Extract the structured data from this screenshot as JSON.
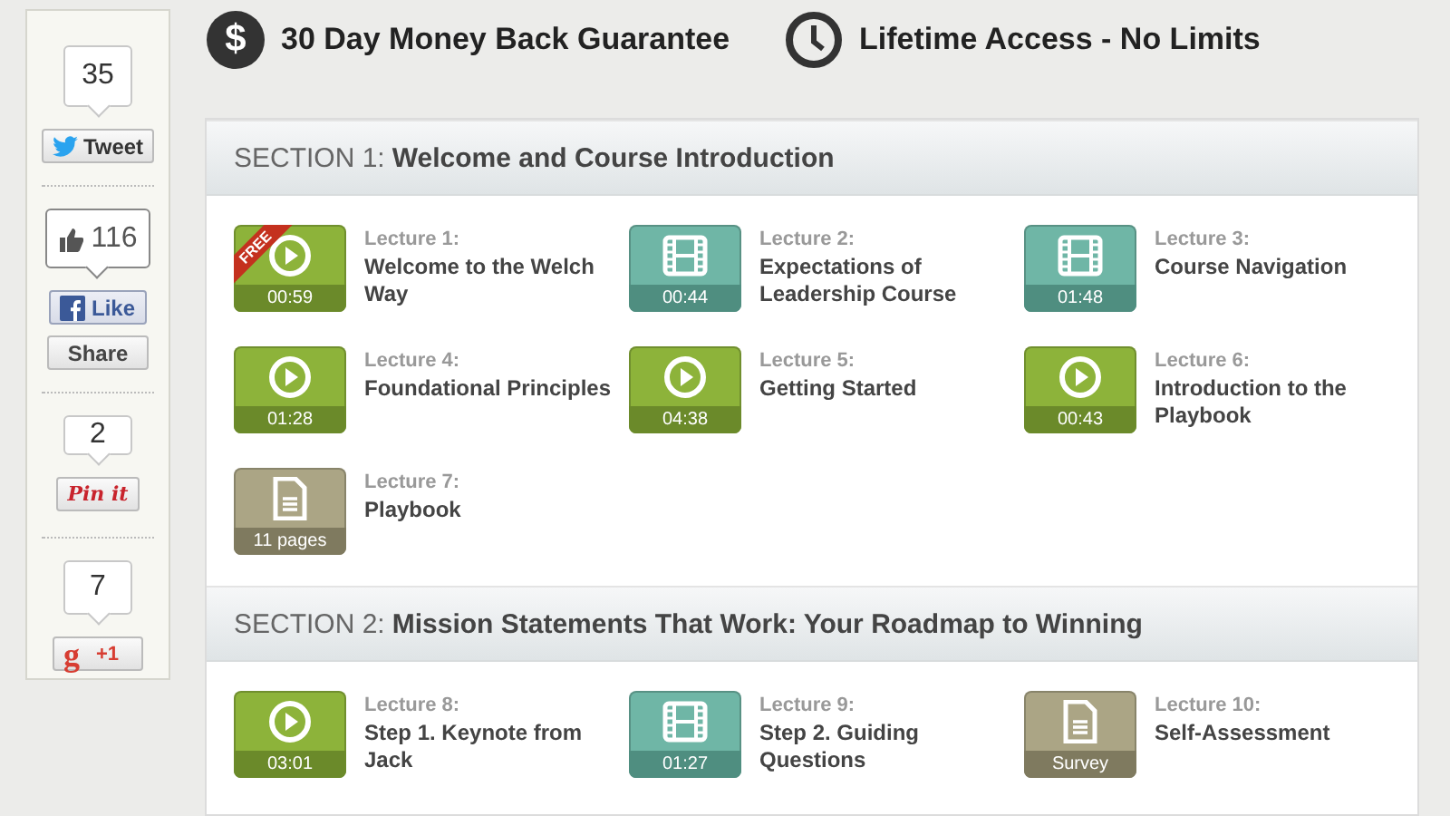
{
  "social": [
    {
      "kind": "twitter",
      "count": "35",
      "buttons": [
        "Tweet"
      ]
    },
    {
      "kind": "facebook",
      "count": "116",
      "buttons": [
        "Like",
        "Share"
      ]
    },
    {
      "kind": "pinterest",
      "count": "2",
      "buttons": [
        "Pin it"
      ]
    },
    {
      "kind": "gplus",
      "count": "7",
      "buttons": [
        "+1"
      ],
      "icon": "g"
    }
  ],
  "guarantees": [
    {
      "kind": "money",
      "icon": "$",
      "text": "30 Day Money Back Guarantee"
    },
    {
      "kind": "clock",
      "text": "Lifetime Access - No Limits"
    }
  ],
  "sections": [
    {
      "label": "SECTION 1:",
      "title": "Welcome and Course Introduction",
      "lectures": [
        {
          "kind": "video",
          "label": "Lecture 1:",
          "title": "Welcome to the Welch Way",
          "duration": "00:59",
          "badge": "FREE"
        },
        {
          "kind": "film",
          "label": "Lecture 2:",
          "title": "Expectations of Leadership Course",
          "duration": "00:44"
        },
        {
          "kind": "film",
          "label": "Lecture 3:",
          "title": "Course Navigation",
          "duration": "01:48"
        },
        {
          "kind": "video",
          "label": "Lecture 4:",
          "title": "Foundational Principles",
          "duration": "01:28"
        },
        {
          "kind": "video",
          "label": "Lecture 5:",
          "title": "Getting Started",
          "duration": "04:38"
        },
        {
          "kind": "video",
          "label": "Lecture 6:",
          "title": "Introduction to the Playbook",
          "duration": "00:43"
        },
        {
          "kind": "doc",
          "label": "Lecture 7:",
          "title": "Playbook",
          "duration": "11 pages"
        }
      ]
    },
    {
      "label": "SECTION 2:",
      "title": "Mission Statements That Work: Your Roadmap to Winning",
      "lectures": [
        {
          "kind": "video",
          "label": "Lecture 8:",
          "title": "Step 1. Keynote from Jack",
          "duration": "03:01"
        },
        {
          "kind": "film",
          "label": "Lecture 9:",
          "title": "Step 2. Guiding Questions",
          "duration": "01:27"
        },
        {
          "kind": "doc",
          "label": "Lecture 10:",
          "title": "Self-Assessment",
          "duration": "Survey"
        }
      ]
    }
  ]
}
